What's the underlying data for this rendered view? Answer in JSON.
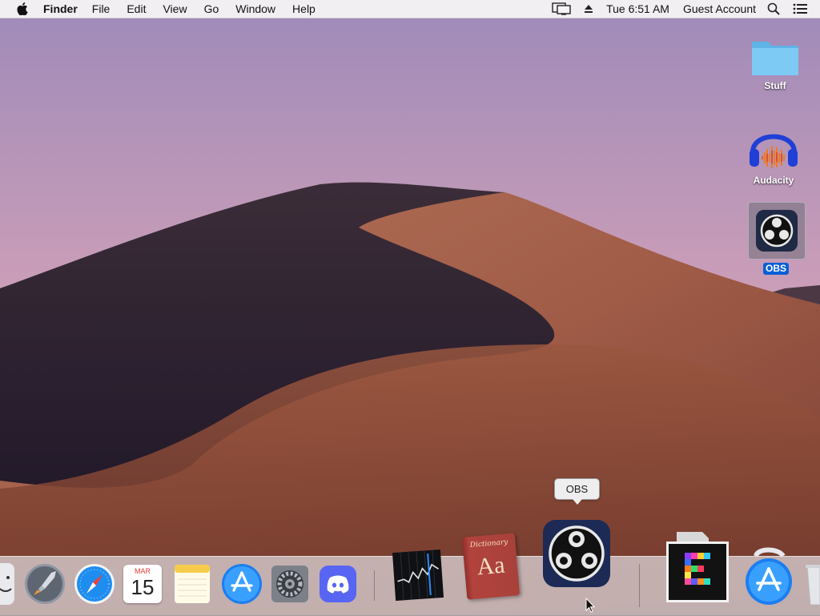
{
  "menubar": {
    "app_name": "Finder",
    "menus": [
      "File",
      "Edit",
      "View",
      "Go",
      "Window",
      "Help"
    ],
    "clock": "Tue 6:51 AM",
    "user": "Guest Account",
    "icons": [
      "apple-icon",
      "display-mirroring-icon",
      "eject-icon",
      "spotlight-icon",
      "notification-center-icon"
    ]
  },
  "desktop": {
    "icons": [
      {
        "label": "Stuff",
        "icon": "folder-icon",
        "selected": false
      },
      {
        "label": "Audacity",
        "icon": "audacity-icon",
        "selected": false
      },
      {
        "label": "OBS",
        "icon": "obs-icon",
        "selected": true
      }
    ]
  },
  "dock": {
    "tooltip": "OBS",
    "calendar": {
      "month": "MAR",
      "day": "15"
    },
    "dictionary_text": "Dictionary",
    "dictionary_glyph": "Aa",
    "apps": [
      "finder-icon",
      "launchpad-icon",
      "safari-icon",
      "calendar-icon",
      "notes-icon",
      "app-store-icon",
      "system-preferences-icon",
      "discord-icon",
      "stocks-icon",
      "dictionary-icon",
      "obs-icon",
      "enhanced-app-icon",
      "app-store-downloads-icon",
      "trash-icon"
    ]
  },
  "colors": {
    "menubar_bg": "#f6f4f6",
    "selection": "#0a5fd6",
    "folder": "#6ec4f2",
    "obs_bg": "#1f2a44",
    "discord": "#5865f2"
  }
}
